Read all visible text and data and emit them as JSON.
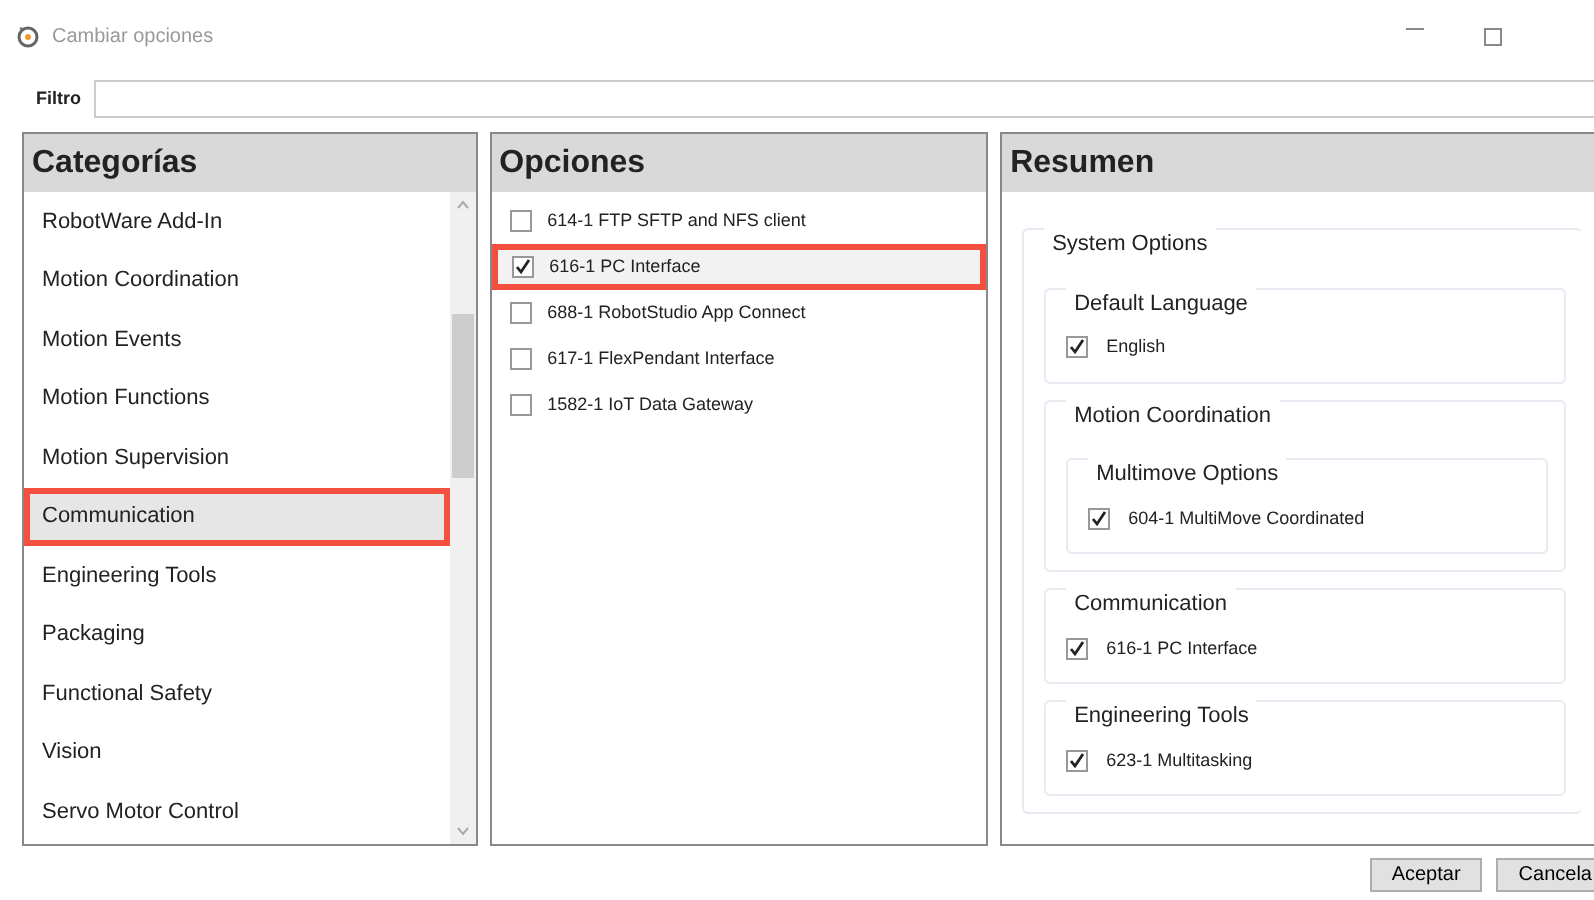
{
  "window": {
    "title": "Cambiar opciones"
  },
  "filter": {
    "label": "Filtro"
  },
  "categories": {
    "heading": "Categorías",
    "items": [
      {
        "label": "RobotWare Add-In",
        "selected": false,
        "highlighted": false
      },
      {
        "label": "Motion Coordination",
        "selected": false,
        "highlighted": false
      },
      {
        "label": "Motion Events",
        "selected": false,
        "highlighted": false
      },
      {
        "label": "Motion Functions",
        "selected": false,
        "highlighted": false
      },
      {
        "label": "Motion Supervision",
        "selected": false,
        "highlighted": false
      },
      {
        "label": "Communication",
        "selected": true,
        "highlighted": true
      },
      {
        "label": "Engineering Tools",
        "selected": false,
        "highlighted": false
      },
      {
        "label": "Packaging",
        "selected": false,
        "highlighted": false
      },
      {
        "label": "Functional Safety",
        "selected": false,
        "highlighted": false
      },
      {
        "label": "Vision",
        "selected": false,
        "highlighted": false
      },
      {
        "label": "Servo Motor Control",
        "selected": false,
        "highlighted": false
      }
    ]
  },
  "options": {
    "heading": "Opciones",
    "items": [
      {
        "label": "614-1 FTP SFTP and NFS client",
        "checked": false,
        "selected": false,
        "highlighted": false
      },
      {
        "label": "616-1 PC Interface",
        "checked": true,
        "selected": true,
        "highlighted": true
      },
      {
        "label": "688-1 RobotStudio App Connect",
        "checked": false,
        "selected": false,
        "highlighted": false
      },
      {
        "label": "617-1 FlexPendant Interface",
        "checked": false,
        "selected": false,
        "highlighted": false
      },
      {
        "label": "1582-1 IoT Data Gateway",
        "checked": false,
        "selected": false,
        "highlighted": false
      }
    ]
  },
  "summary": {
    "heading": "Resumen",
    "groups": [
      {
        "title": "System Options",
        "children": [
          {
            "title": "Default Language",
            "items": [
              {
                "label": "English",
                "checked": true
              }
            ]
          },
          {
            "title": "Motion Coordination",
            "children": [
              {
                "title": "Multimove Options",
                "items": [
                  {
                    "label": "604-1 MultiMove Coordinated",
                    "checked": true
                  }
                ]
              }
            ]
          },
          {
            "title": "Communication",
            "items": [
              {
                "label": "616-1 PC Interface",
                "checked": true
              }
            ]
          },
          {
            "title": "Engineering Tools",
            "items": [
              {
                "label": "623-1 Multitasking",
                "checked": true
              }
            ]
          }
        ]
      }
    ]
  },
  "buttons": [
    {
      "label": "Aceptar"
    },
    {
      "label": "Cancela"
    }
  ]
}
